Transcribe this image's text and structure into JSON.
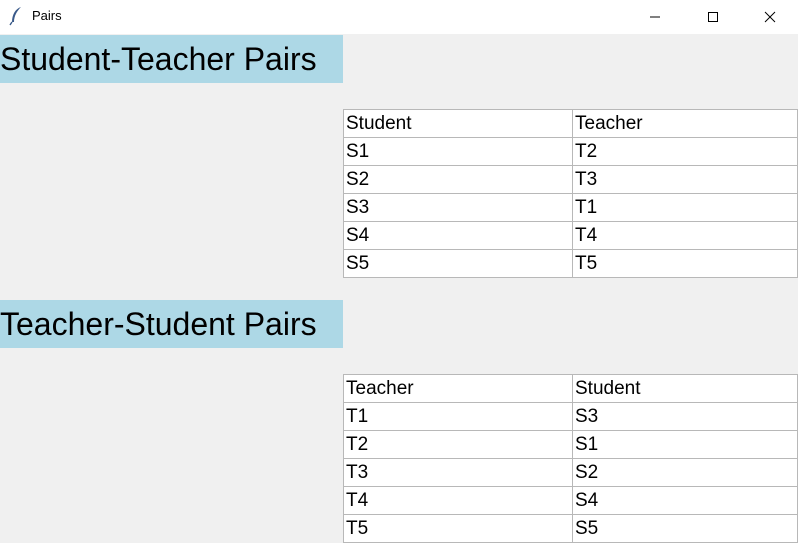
{
  "window": {
    "title": "Pairs",
    "app_icon": "feather-icon",
    "controls": [
      "minimize-icon",
      "maximize-icon",
      "close-icon"
    ]
  },
  "colors": {
    "heading_bg": "#add8e6",
    "window_bg": "#f0f0f0"
  },
  "section1": {
    "title": "Student-Teacher Pairs",
    "headers": [
      "Student",
      "Teacher"
    ],
    "rows": [
      [
        "S1",
        "T2"
      ],
      [
        "S2",
        "T3"
      ],
      [
        "S3",
        "T1"
      ],
      [
        "S4",
        "T4"
      ],
      [
        "S5",
        "T5"
      ]
    ]
  },
  "section2": {
    "title": "Teacher-Student Pairs",
    "headers": [
      "Teacher",
      "Student"
    ],
    "rows": [
      [
        "T1",
        "S3"
      ],
      [
        "T2",
        "S1"
      ],
      [
        "T3",
        "S2"
      ],
      [
        "T4",
        "S4"
      ],
      [
        "T5",
        "S5"
      ]
    ]
  }
}
